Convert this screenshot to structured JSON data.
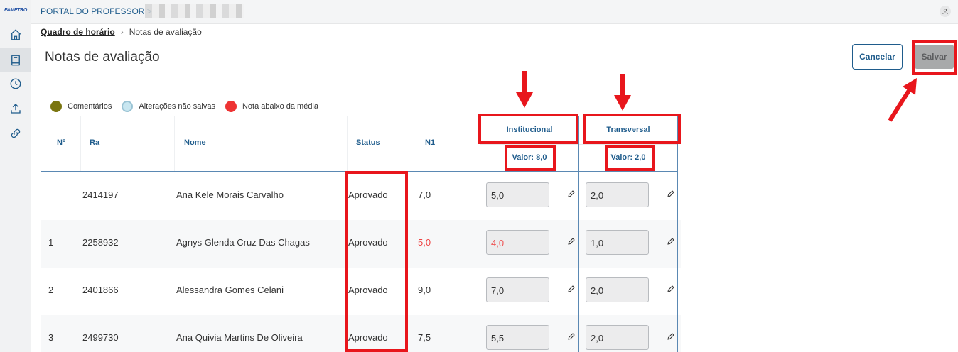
{
  "logo": "FAMETRO",
  "topbar": {
    "portal_title": "PORTAL DO PROFESSOR >"
  },
  "breadcrumb": {
    "link": "Quadro de horário",
    "separator": "›",
    "current": "Notas de avaliação"
  },
  "page": {
    "title": "Notas de avaliação"
  },
  "actions": {
    "cancel_label": "Cancelar",
    "save_label": "Salvar"
  },
  "legend": [
    {
      "label": "Comentários",
      "color": "#7a7510"
    },
    {
      "label": "Alterações não salvas",
      "color": "#c8e6f0"
    },
    {
      "label": "Nota abaixo da média",
      "color": "#ee3333"
    }
  ],
  "table": {
    "headers": {
      "num": "Nº",
      "ra": "Ra",
      "nome": "Nome",
      "status": "Status",
      "n1": "N1"
    },
    "groups": [
      {
        "title": "Institucional",
        "valor": "Valor: 8,0"
      },
      {
        "title": "Transversal",
        "valor": "Valor: 2,0"
      }
    ],
    "rows": [
      {
        "num": "",
        "ra": "2414197",
        "nome": "Ana Kele Morais Carvalho",
        "status": "Aprovado",
        "n1": "7,0",
        "institucional": "5,0",
        "transversal": "2,0"
      },
      {
        "num": "1",
        "ra": "2258932",
        "nome": "Agnys Glenda Cruz Das Chagas",
        "status": "Aprovado",
        "n1": "5,0",
        "institucional": "4,0",
        "transversal": "1,0"
      },
      {
        "num": "2",
        "ra": "2401866",
        "nome": "Alessandra Gomes Celani",
        "status": "Aprovado",
        "n1": "9,0",
        "institucional": "7,0",
        "transversal": "2,0"
      },
      {
        "num": "3",
        "ra": "2499730",
        "nome": "Ana Quivia Martins De Oliveira",
        "status": "Aprovado",
        "n1": "7,5",
        "institucional": "5,5",
        "transversal": "2,0"
      }
    ]
  },
  "colors": {
    "accent": "#1f5c8c",
    "annotation": "#e8161c",
    "below_average": "#ee4444"
  }
}
